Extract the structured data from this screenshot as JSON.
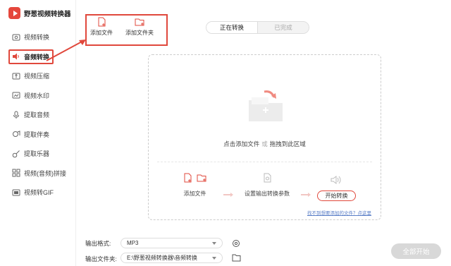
{
  "app": {
    "title": "野葱视频转换器"
  },
  "sidebar": {
    "items": [
      {
        "label": "视频转换",
        "icon": "video-convert-icon"
      },
      {
        "label": "音频转换",
        "icon": "audio-icon",
        "active": true
      },
      {
        "label": "视频压缩",
        "icon": "compress-icon"
      },
      {
        "label": "视频水印",
        "icon": "watermark-icon"
      },
      {
        "label": "提取音频",
        "icon": "extract-audio-icon"
      },
      {
        "label": "提取伴奏",
        "icon": "accompaniment-icon"
      },
      {
        "label": "提取乐器",
        "icon": "guitar-icon"
      },
      {
        "label": "视频(音频)拼接",
        "icon": "merge-icon"
      },
      {
        "label": "视频转GIF",
        "icon": "gif-icon"
      }
    ]
  },
  "toolbar": {
    "add_file": "添加文件",
    "add_folder": "添加文件夹"
  },
  "tabs": {
    "converting": "正在转换",
    "completed": "已完成"
  },
  "drop": {
    "main_prefix": "点击添加文件",
    "or": "或",
    "main_suffix": "拖拽到此区域",
    "steps": {
      "add_file": "添加文件",
      "settings": "设置输出转换参数",
      "start": "开始转换"
    },
    "help_link": "找不到想要添加的文件？点这里"
  },
  "output": {
    "format_label": "输出格式:",
    "format_value": "MP3",
    "folder_label": "输出文件夹:",
    "folder_value": "E:\\野葱视频转换器\\音频转换"
  },
  "start_all": "全部开始",
  "colors": {
    "accent": "#e0483c",
    "disabled": "#d8d8d8"
  }
}
